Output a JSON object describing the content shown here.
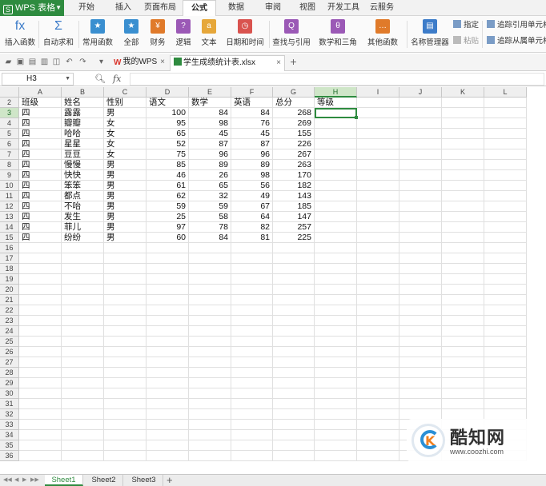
{
  "app": {
    "name": "WPS 表格",
    "logo": "S"
  },
  "menu": [
    "开始",
    "插入",
    "页面布局",
    "公式",
    "数据",
    "审阅",
    "视图",
    "开发工具",
    "云服务"
  ],
  "active_menu": 3,
  "ribbon": {
    "buttons": [
      {
        "label": "插入函数",
        "icon": "fx"
      },
      {
        "label": "自动求和",
        "icon": "Σ"
      },
      {
        "label": "常用函数",
        "icon": "★"
      },
      {
        "label": "全部",
        "icon": "★"
      },
      {
        "label": "财务",
        "icon": "¥"
      },
      {
        "label": "逻辑",
        "icon": "?"
      },
      {
        "label": "文本",
        "icon": "a"
      },
      {
        "label": "日期和时间",
        "icon": "◷"
      },
      {
        "label": "查找与引用",
        "icon": "Q"
      },
      {
        "label": "数学和三角",
        "icon": "θ"
      },
      {
        "label": "其他函数",
        "icon": "…"
      },
      {
        "label": "名称管理器",
        "icon": "▤"
      }
    ],
    "small": [
      "指定",
      "粘贴",
      "追踪引用单元格",
      "追踪从属单元格"
    ]
  },
  "doc_tabs": [
    {
      "label": "我的WPS",
      "icon_color": "#d9342b"
    },
    {
      "label": "学生成绩统计表.xlsx",
      "icon_color": "#2e8b3f"
    }
  ],
  "formula_bar": {
    "name_box": "H3",
    "fx": "fx",
    "value": ""
  },
  "columns": [
    "A",
    "B",
    "C",
    "D",
    "E",
    "F",
    "G",
    "H",
    "I",
    "J",
    "K",
    "L"
  ],
  "selected": {
    "col": "H",
    "row": "3"
  },
  "header_row": {
    "row": "2",
    "values": [
      "班级",
      "姓名",
      "性别",
      "语文",
      "数学",
      "英语",
      "总分",
      "等级"
    ]
  },
  "rows": [
    {
      "row": "3",
      "values": [
        "四",
        "露露",
        "男",
        "100",
        "84",
        "84",
        "268"
      ]
    },
    {
      "row": "4",
      "values": [
        "四",
        "瓣瓣",
        "女",
        "95",
        "98",
        "76",
        "269"
      ]
    },
    {
      "row": "5",
      "values": [
        "四",
        "哈哈",
        "女",
        "65",
        "45",
        "45",
        "155"
      ]
    },
    {
      "row": "6",
      "values": [
        "四",
        "星星",
        "女",
        "52",
        "87",
        "87",
        "226"
      ]
    },
    {
      "row": "7",
      "values": [
        "四",
        "豆豆",
        "女",
        "75",
        "96",
        "96",
        "267"
      ]
    },
    {
      "row": "8",
      "values": [
        "四",
        "慢慢",
        "男",
        "85",
        "89",
        "89",
        "263"
      ]
    },
    {
      "row": "9",
      "values": [
        "四",
        "快快",
        "男",
        "46",
        "26",
        "98",
        "170"
      ]
    },
    {
      "row": "10",
      "values": [
        "四",
        "笨笨",
        "男",
        "61",
        "65",
        "56",
        "182"
      ]
    },
    {
      "row": "11",
      "values": [
        "四",
        "都点",
        "男",
        "62",
        "32",
        "49",
        "143"
      ]
    },
    {
      "row": "12",
      "values": [
        "四",
        "不咍",
        "男",
        "59",
        "59",
        "67",
        "185"
      ]
    },
    {
      "row": "13",
      "values": [
        "四",
        "发生",
        "男",
        "25",
        "58",
        "64",
        "147"
      ]
    },
    {
      "row": "14",
      "values": [
        "四",
        "菲儿",
        "男",
        "97",
        "78",
        "82",
        "257"
      ]
    },
    {
      "row": "15",
      "values": [
        "四",
        "纷纷",
        "男",
        "60",
        "84",
        "81",
        "225"
      ]
    }
  ],
  "empty_rows": [
    "16",
    "17",
    "18",
    "19",
    "20",
    "21",
    "22",
    "23",
    "24",
    "25",
    "26",
    "27",
    "28",
    "29",
    "30",
    "31",
    "32",
    "33",
    "34",
    "35",
    "36"
  ],
  "sheets": [
    "Sheet1",
    "Sheet2",
    "Sheet3"
  ],
  "active_sheet": 0,
  "watermark": {
    "title": "酷知网",
    "url": "www.coozhi.com",
    "mark": "K"
  },
  "colors": {
    "accent": "#2e8b3f",
    "selection": "#cfe6c8"
  }
}
